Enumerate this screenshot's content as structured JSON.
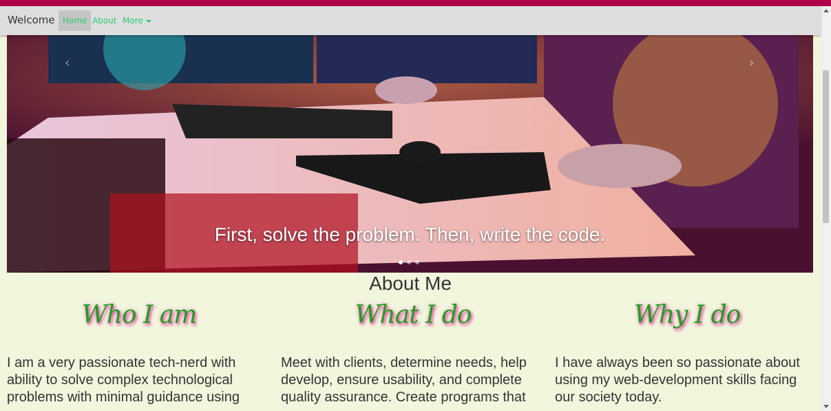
{
  "navbar": {
    "brand": "Welcome",
    "items": [
      {
        "label": "Home",
        "active": true
      },
      {
        "label": "About"
      },
      {
        "label": "More"
      }
    ]
  },
  "carousel": {
    "prev_icon": "‹",
    "next_icon": "›",
    "caption": "First, solve the problem. Then, write the code.",
    "slide_count": 3,
    "active_index": 0
  },
  "about": {
    "title": "About Me",
    "columns": [
      {
        "heading": "Who I am",
        "text": "I am a very passionate tech-nerd with ability to solve complex technological problems with minimal guidance using"
      },
      {
        "heading": "What I do",
        "text": "Meet with clients, determine needs, help develop, ensure usability, and complete quality assurance. Create programs that"
      },
      {
        "heading": "Why I do",
        "text": "I have always been so passionate about using my web-development skills facing our society today."
      }
    ]
  },
  "colors": {
    "top_accent": "#b0004a",
    "nav_link": "#2ecc71",
    "page_bg": "#f1f6dc",
    "heading_green": "#1f9f1f",
    "heading_glow": "#e046a0"
  }
}
